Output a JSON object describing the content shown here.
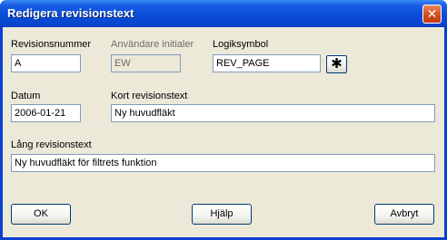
{
  "window": {
    "title": "Redigera revisionstext",
    "close_glyph": "✕"
  },
  "fields": {
    "revision_number": {
      "label": "Revisionsnummer",
      "value": "A"
    },
    "user_initials": {
      "label": "Användare initialer",
      "value": "EW"
    },
    "logic_symbol": {
      "label": "Logiksymbol",
      "value": "REV_PAGE",
      "browse_glyph": "✱"
    },
    "date": {
      "label": "Datum",
      "value": "2006-01-21"
    },
    "short_text": {
      "label": "Kort revisionstext",
      "value": "Ny huvudfläkt"
    },
    "long_text": {
      "label": "Lång revisionstext",
      "value": "Ny huvudfläkt för filtrets funktion"
    }
  },
  "buttons": {
    "ok": "OK",
    "help": "Hjälp",
    "cancel": "Avbryt"
  },
  "icons": {
    "close": "close-icon",
    "browse": "asterisk-icon"
  }
}
